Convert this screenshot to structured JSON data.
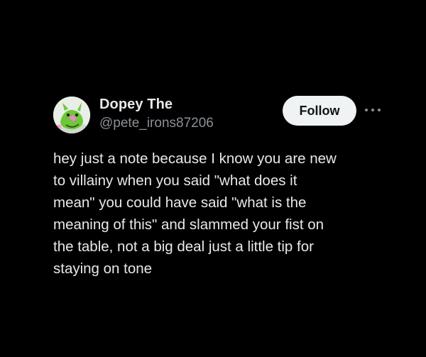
{
  "author": {
    "display_name": "Dopey The",
    "handle": "@pete_irons87206",
    "avatar_icon": "cartoon-character-avatar-icon"
  },
  "actions": {
    "follow_label": "Follow",
    "more_icon": "more-options-icon"
  },
  "tweet": {
    "lines": [
      "hey just a note because I know you are new",
      "to villainy when you said \"what does it",
      "mean\" you could have said \"what is the",
      "meaning of this\" and slammed your fist on",
      "the table, not a big deal just a little tip for",
      "staying on tone"
    ]
  },
  "colors": {
    "background": "#000000",
    "text_primary": "#e7e9ea",
    "text_secondary": "#8b9096",
    "follow_button_bg": "#eff3f4",
    "follow_button_text": "#0f1419"
  }
}
